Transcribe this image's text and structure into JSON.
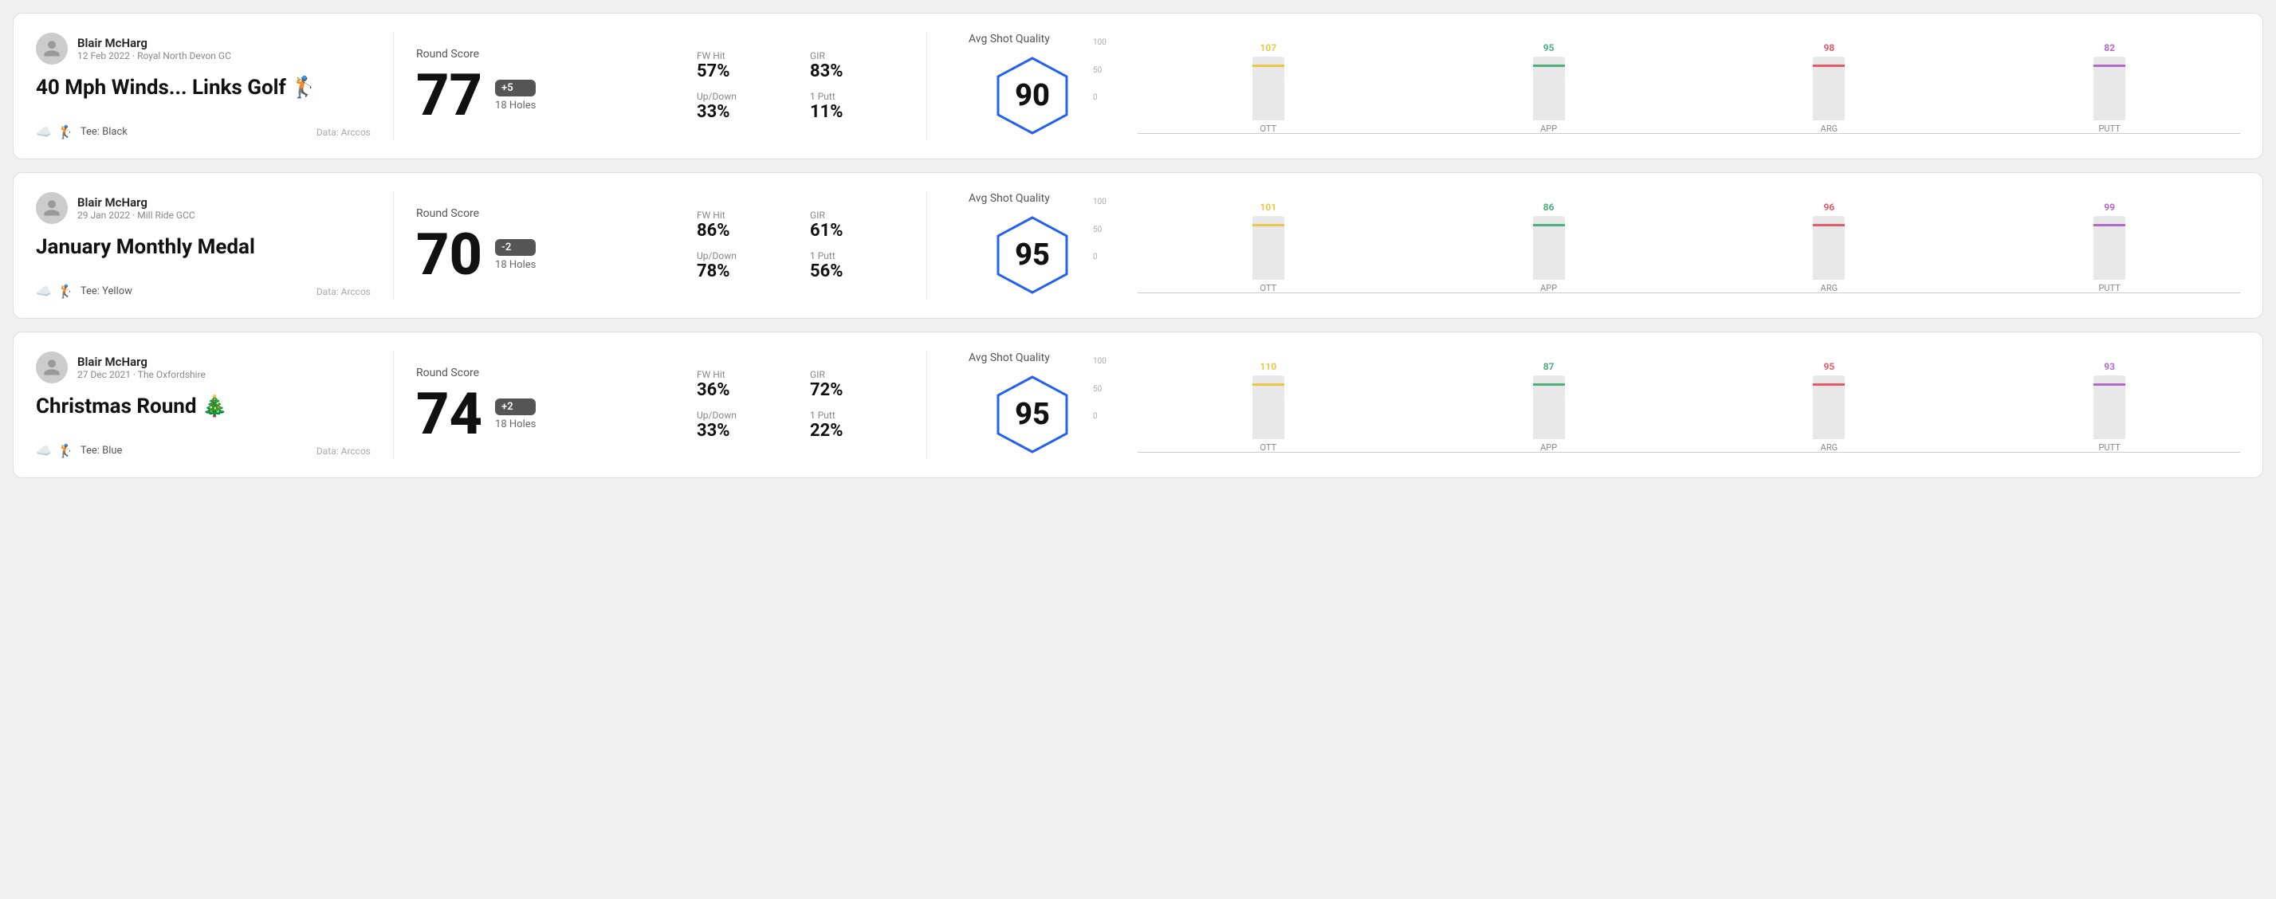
{
  "rounds": [
    {
      "id": "round-1",
      "user": {
        "name": "Blair McHarg",
        "meta": "12 Feb 2022 · Royal North Devon GC"
      },
      "title": "40 Mph Winds... Links Golf 🏌️",
      "tee": "Black",
      "data_source": "Data: Arccos",
      "round_score_label": "Round Score",
      "score": "77",
      "badge": "+5",
      "holes": "18 Holes",
      "fw_hit_label": "FW Hit",
      "fw_hit": "57%",
      "gir_label": "GIR",
      "gir": "83%",
      "updown_label": "Up/Down",
      "updown": "33%",
      "oneputt_label": "1 Putt",
      "oneputt": "11%",
      "avg_shot_label": "Avg Shot Quality",
      "quality_score": "90",
      "chart": {
        "bars": [
          {
            "label": "OTT",
            "value": 107,
            "color": "#e8c84a"
          },
          {
            "label": "APP",
            "value": 95,
            "color": "#4caf7d"
          },
          {
            "label": "ARG",
            "value": 98,
            "color": "#e05c6a"
          },
          {
            "label": "PUTT",
            "value": 82,
            "color": "#b06bc9"
          }
        ],
        "y_max": 100
      }
    },
    {
      "id": "round-2",
      "user": {
        "name": "Blair McHarg",
        "meta": "29 Jan 2022 · Mill Ride GCC"
      },
      "title": "January Monthly Medal",
      "tee": "Yellow",
      "data_source": "Data: Arccos",
      "round_score_label": "Round Score",
      "score": "70",
      "badge": "-2",
      "holes": "18 Holes",
      "fw_hit_label": "FW Hit",
      "fw_hit": "86%",
      "gir_label": "GIR",
      "gir": "61%",
      "updown_label": "Up/Down",
      "updown": "78%",
      "oneputt_label": "1 Putt",
      "oneputt": "56%",
      "avg_shot_label": "Avg Shot Quality",
      "quality_score": "95",
      "chart": {
        "bars": [
          {
            "label": "OTT",
            "value": 101,
            "color": "#e8c84a"
          },
          {
            "label": "APP",
            "value": 86,
            "color": "#4caf7d"
          },
          {
            "label": "ARG",
            "value": 96,
            "color": "#e05c6a"
          },
          {
            "label": "PUTT",
            "value": 99,
            "color": "#b06bc9"
          }
        ],
        "y_max": 100
      }
    },
    {
      "id": "round-3",
      "user": {
        "name": "Blair McHarg",
        "meta": "27 Dec 2021 · The Oxfordshire"
      },
      "title": "Christmas Round 🎄",
      "tee": "Blue",
      "data_source": "Data: Arccos",
      "round_score_label": "Round Score",
      "score": "74",
      "badge": "+2",
      "holes": "18 Holes",
      "fw_hit_label": "FW Hit",
      "fw_hit": "36%",
      "gir_label": "GIR",
      "gir": "72%",
      "updown_label": "Up/Down",
      "updown": "33%",
      "oneputt_label": "1 Putt",
      "oneputt": "22%",
      "avg_shot_label": "Avg Shot Quality",
      "quality_score": "95",
      "chart": {
        "bars": [
          {
            "label": "OTT",
            "value": 110,
            "color": "#e8c84a"
          },
          {
            "label": "APP",
            "value": 87,
            "color": "#4caf7d"
          },
          {
            "label": "ARG",
            "value": 95,
            "color": "#e05c6a"
          },
          {
            "label": "PUTT",
            "value": 93,
            "color": "#b06bc9"
          }
        ],
        "y_max": 100
      }
    }
  ],
  "y_axis_labels": [
    "100",
    "50",
    "0"
  ]
}
